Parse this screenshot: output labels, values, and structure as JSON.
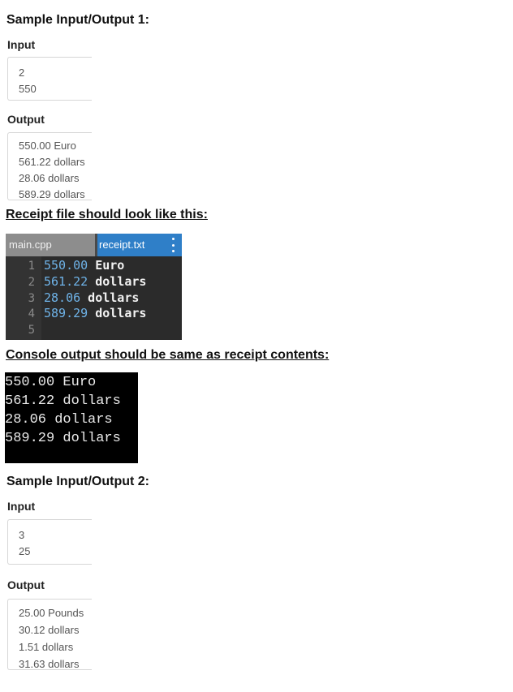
{
  "sample1": {
    "heading": "Sample Input/Output 1:",
    "input_label": "Input",
    "input_lines": [
      "2",
      "550"
    ],
    "output_label": "Output",
    "output_lines": [
      "550.00 Euro",
      "561.22 dollars",
      "28.06 dollars",
      "589.29 dollars"
    ]
  },
  "receipt_heading": "Receipt file should look like this:",
  "editor": {
    "tabs": [
      "main.cpp",
      "receipt.txt"
    ],
    "menu_icon": "kebab-menu-icon",
    "lines": [
      {
        "num": "1",
        "value": "550.00",
        "word": " Euro"
      },
      {
        "num": "2",
        "value": "561.22",
        "word": " dollars"
      },
      {
        "num": "3",
        "value": "28.06",
        "word": " dollars"
      },
      {
        "num": "4",
        "value": "589.29",
        "word": " dollars"
      },
      {
        "num": "5",
        "value": "",
        "word": ""
      }
    ]
  },
  "console_heading": "Console output should be same as receipt contents:",
  "console_lines": [
    "550.00 Euro",
    "561.22 dollars",
    "28.06 dollars",
    "589.29 dollars"
  ],
  "sample2": {
    "heading": "Sample Input/Output 2:",
    "input_label": "Input",
    "input_lines": [
      "3",
      "25"
    ],
    "output_label": "Output",
    "output_lines": [
      "25.00 Pounds",
      "30.12 dollars",
      "1.51 dollars",
      "31.63 dollars"
    ]
  },
  "colors": {
    "tab_active": "#2f7fc8",
    "tab_inactive": "#8d8d8d",
    "editor_bg": "#2b2b2b",
    "number_color": "#6fb3e8",
    "console_bg": "#000000"
  }
}
